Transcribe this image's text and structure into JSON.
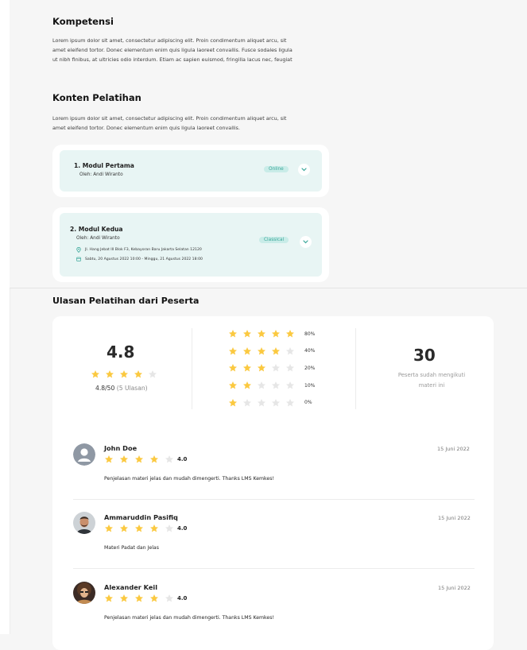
{
  "kompetensi": {
    "heading": "Kompetensi",
    "lines": [
      "Lorem ipsum dolor sit amet, consectetur adipiscing elit. Proin condimentum aliquet arcu, sit",
      "amet eleifend tortor. Donec elementum enim quis ligula laoreet convallis. Fusce sodales ligula",
      "ut nibh finibus, at ultricies odio interdum. Etiam ac sapien euismod, fringilla lacus nec, feugiat"
    ]
  },
  "konten": {
    "heading": "Konten Pelatihan",
    "lines": [
      "Lorem ipsum dolor sit amet, consectetur adipiscing elit. Proin condimentum aliquet arcu, sit",
      "amet eleifend tortor. Donec elementum enim quis ligula laoreet convallis."
    ],
    "modules": [
      {
        "title": "1. Modul Pertama",
        "author": "Oleh: Andi Wiranto",
        "badge": "Online"
      },
      {
        "title": "2. Modul Kedua",
        "author": "Oleh: Andi Wiranto",
        "badge": "Classical",
        "location": "Jl. Hang Jebat III Blok F3, Kebayoran Baru Jakarta Selatan 12120",
        "schedule": "Sabtu, 20 Agustus 2022 10:00 - Minggu, 21 Agustus 2022 18:00"
      }
    ]
  },
  "ulasan": {
    "heading": "Ulasan Pelatihan dari Peserta",
    "average": "4.8",
    "average_stars": 4,
    "average_caption": "4.8/50",
    "average_count": "(5 Ulasan)",
    "distribution": [
      {
        "stars": 5,
        "percent": "80%"
      },
      {
        "stars": 4,
        "percent": "40%"
      },
      {
        "stars": 3,
        "percent": "20%"
      },
      {
        "stars": 2,
        "percent": "10%"
      },
      {
        "stars": 1,
        "percent": "0%"
      }
    ],
    "participants": "30",
    "participants_label_1": "Peserta sudah mengikuti",
    "participants_label_2": "materi ini",
    "reviews": [
      {
        "name": "John Doe",
        "stars": 4,
        "rating": "4.0",
        "date": "15 Juni 2022",
        "text": "Penjelasan materi jelas dan mudah dimengerti. Thanks LMS Kemkes!",
        "avatar": "default-user-icon"
      },
      {
        "name": "Ammaruddin Pasifiq",
        "stars": 4,
        "rating": "4.0",
        "date": "15 Juni 2022",
        "text": "Materi Padat dan Jelas",
        "avatar": "photo-male"
      },
      {
        "name": "Alexander Keil",
        "stars": 4,
        "rating": "4.0",
        "date": "15 Juni 2022",
        "text": "Penjelasan materi jelas dan mudah dimengerti. Thanks LMS Kemkes!",
        "avatar": "photo-curly"
      }
    ]
  },
  "colors": {
    "star_on": "#fbc940",
    "star_off": "#e6e6e6",
    "accent": "#3aa79a",
    "module_bg": "#e8f5f4"
  }
}
